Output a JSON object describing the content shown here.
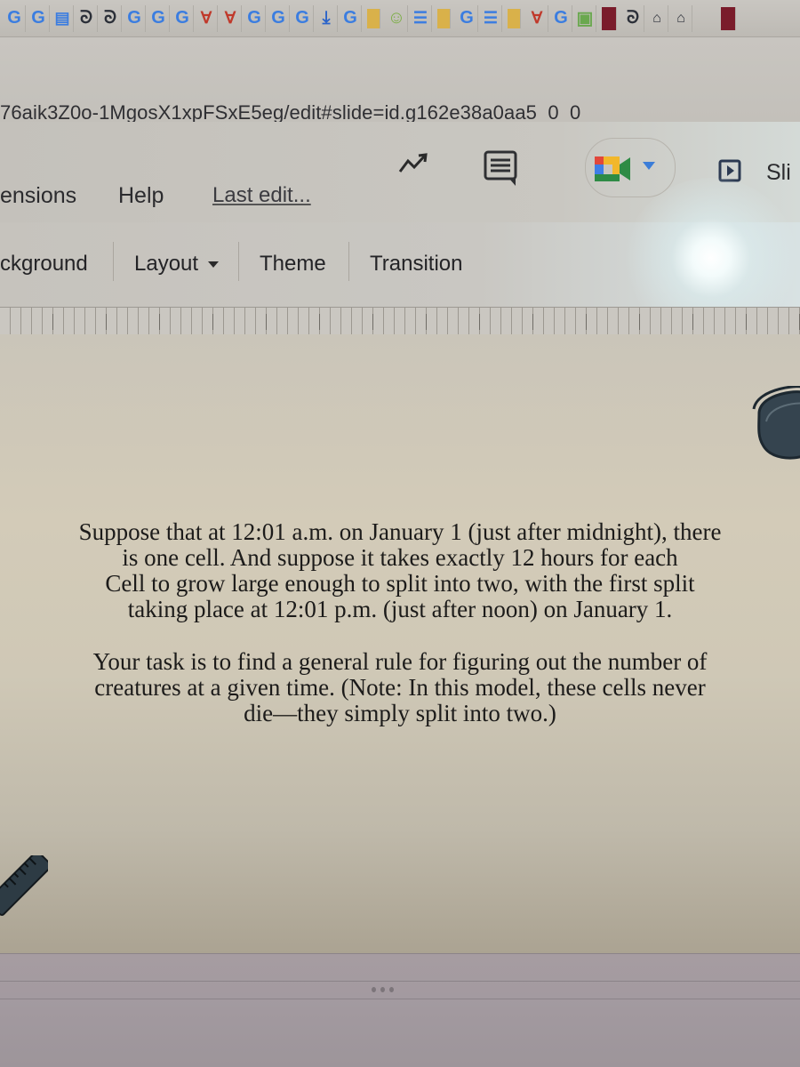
{
  "browser": {
    "bookmarks": [
      {
        "icon": "google-icon"
      },
      {
        "icon": "google-icon"
      },
      {
        "icon": "google-docs-icon"
      },
      {
        "icon": "swirl-icon"
      },
      {
        "icon": "swirl-icon"
      },
      {
        "icon": "google-icon"
      },
      {
        "icon": "google-icon"
      },
      {
        "icon": "google-icon"
      },
      {
        "icon": "vivaldi-icon"
      },
      {
        "icon": "vivaldi-icon"
      },
      {
        "icon": "google-icon"
      },
      {
        "icon": "google-icon"
      },
      {
        "icon": "google-icon"
      },
      {
        "icon": "download-icon"
      },
      {
        "icon": "google-icon"
      },
      {
        "icon": "folder-icon"
      },
      {
        "icon": "mascot-icon"
      },
      {
        "icon": "document-icon"
      },
      {
        "icon": "folder-icon"
      },
      {
        "icon": "google-icon"
      },
      {
        "icon": "document-icon"
      },
      {
        "icon": "folder-icon"
      },
      {
        "icon": "vivaldi-icon"
      },
      {
        "icon": "google-icon"
      },
      {
        "icon": "classroom-icon"
      },
      {
        "icon": "book-icon"
      },
      {
        "icon": "swirl-icon"
      },
      {
        "icon": "school-icon"
      },
      {
        "icon": "school-icon"
      },
      {
        "icon": "book-icon"
      }
    ],
    "url": "76aik3Z0o-1MgosX1xpFSxE5eg/edit#slide=id.g162e38a0aa5_0_0"
  },
  "app": {
    "menu": {
      "extensions_label": "ensions",
      "help_label": "Help",
      "last_edit_label": "Last edit..."
    },
    "header_icons": [
      "activity-trend-icon",
      "comment-icon",
      "google-meet-icon"
    ],
    "slideshow_label": "Sli",
    "toolbar": {
      "background_label": "ckground",
      "layout_label": "Layout",
      "theme_label": "Theme",
      "transition_label": "Transition"
    }
  },
  "slide": {
    "paragraph1": [
      "Suppose that at 12:01 a.m. on January 1 (just after midnight), there",
      "is one cell. And suppose it takes exactly 12 hours for each",
      "Cell to grow large enough to split into two, with the first split",
      "taking place at 12:01 p.m. (just after noon) on January 1."
    ],
    "paragraph2": [
      "Your task is to find a general rule for figuring out the number of",
      "creatures at a given time. (Note: In this model, these cells never",
      "die—they simply split into two.)"
    ]
  },
  "colors": {
    "meet_green": "#2e8b45",
    "meet_blue": "#3f7ee6",
    "meet_yellow": "#f2b72b",
    "meet_red": "#e1473b",
    "dropdown_blue": "#3b7dd8"
  }
}
